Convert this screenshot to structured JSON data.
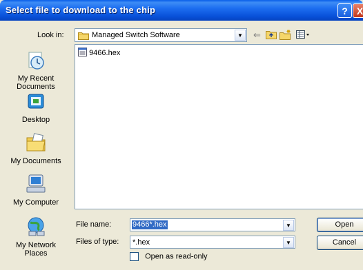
{
  "window": {
    "title": "Select file to download to the chip",
    "help_label": "?",
    "close_label": "X"
  },
  "lookin": {
    "label": "Look in:",
    "value": "Managed Switch Software"
  },
  "toolbar": {
    "icons": [
      "back-icon",
      "up-folder-icon",
      "new-folder-icon",
      "views-menu-icon"
    ]
  },
  "places": [
    {
      "icon": "my-recent-documents-icon",
      "lines": [
        "My Recent",
        "Documents"
      ]
    },
    {
      "icon": "desktop-icon",
      "lines": [
        "Desktop"
      ]
    },
    {
      "icon": "my-documents-icon",
      "lines": [
        "My Documents"
      ]
    },
    {
      "icon": "my-computer-icon",
      "lines": [
        "My Computer"
      ]
    },
    {
      "icon": "my-network-places-icon",
      "lines": [
        "My Network",
        "Places"
      ]
    }
  ],
  "files": [
    {
      "name": "9466.hex",
      "icon": "hex-file-icon"
    }
  ],
  "filename": {
    "label": "File name:",
    "value": "9466*.hex"
  },
  "filetype": {
    "label": "Files of type:",
    "value": "*.hex"
  },
  "readonly": {
    "label": "Open as read-only",
    "checked": false
  },
  "buttons": {
    "open": "Open",
    "cancel": "Cancel"
  }
}
